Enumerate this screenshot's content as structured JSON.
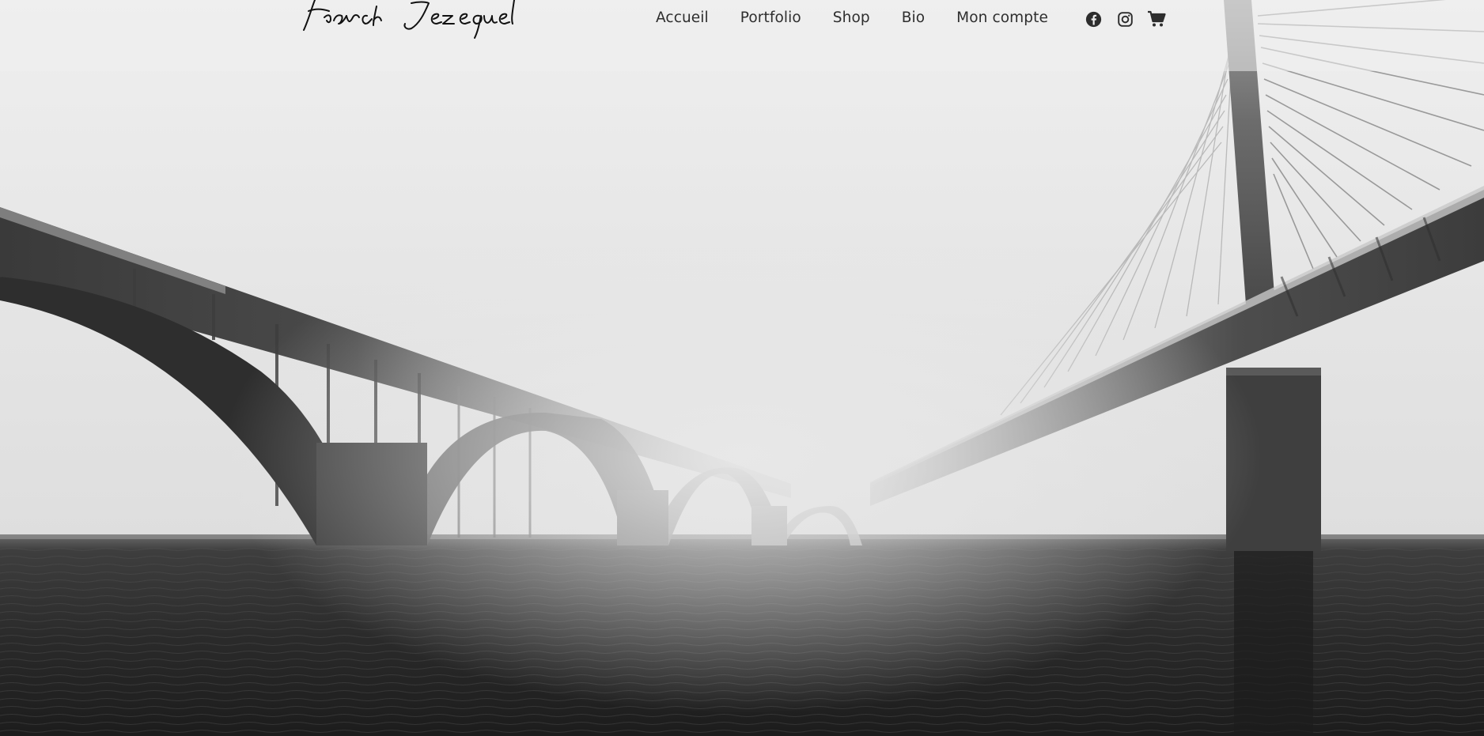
{
  "site": {
    "logo_text": "Franck Jezequel"
  },
  "nav": {
    "items": [
      {
        "label": "Accueil"
      },
      {
        "label": "Portfolio"
      },
      {
        "label": "Shop"
      },
      {
        "label": "Bio"
      },
      {
        "label": "Mon compte"
      }
    ]
  },
  "social": {
    "icons": [
      "facebook-icon",
      "instagram-icon",
      "cart-icon"
    ]
  },
  "colors": {
    "nav_text": "#2d2d2d",
    "icon": "#2d2d2d",
    "sky": "#ececec",
    "water": "#2a2a2a"
  }
}
